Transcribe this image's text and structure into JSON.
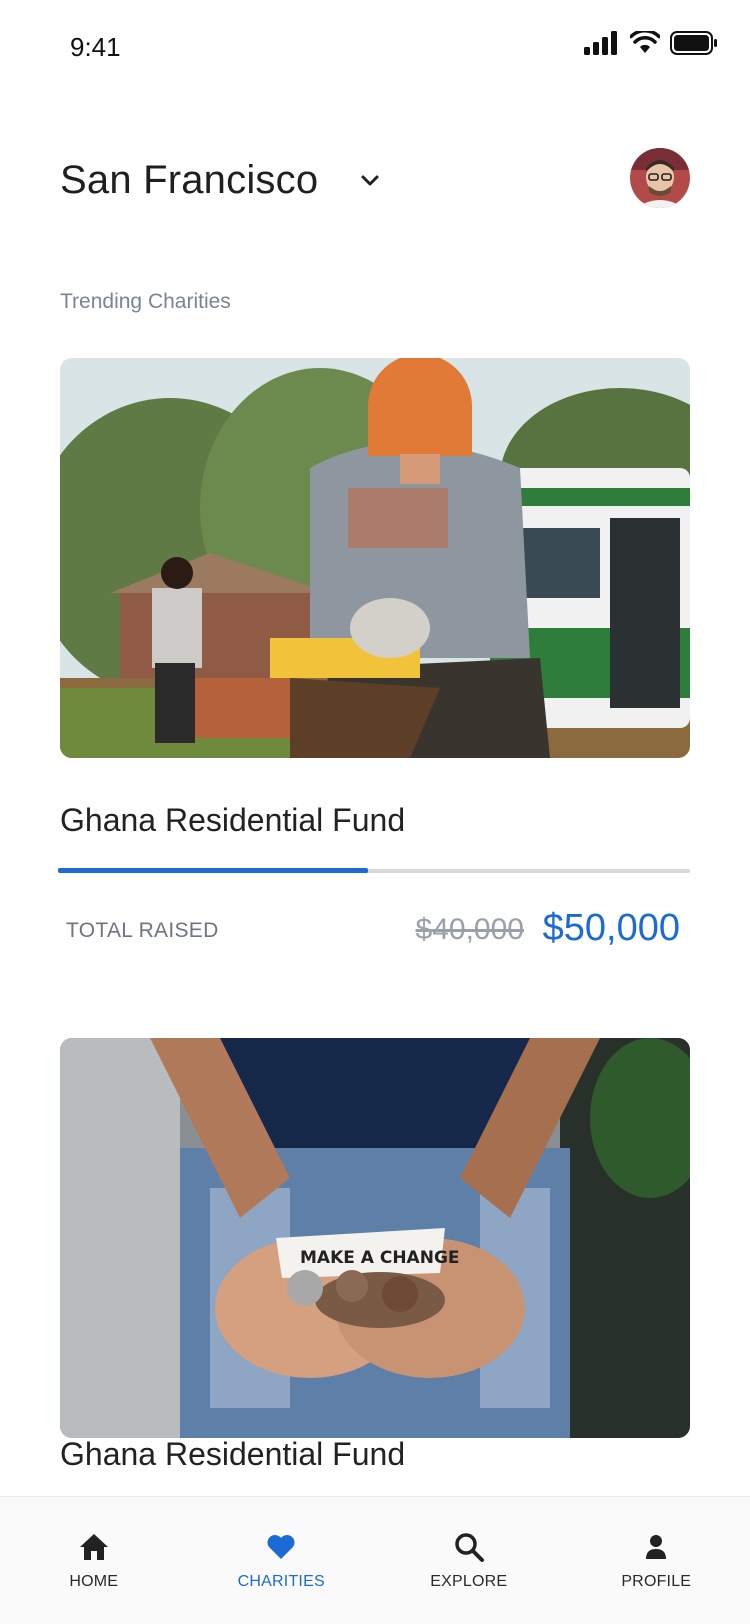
{
  "status_bar": {
    "time": "9:41"
  },
  "header": {
    "city": "San Francisco"
  },
  "section": {
    "title": "Trending Charities"
  },
  "charities": [
    {
      "title": "Ghana Residential Fund",
      "raised_label": "TOTAL RAISED",
      "old_amount": "$40,000",
      "new_amount": "$50,000",
      "progress": 0.49
    },
    {
      "title": "Ghana Residential Fund"
    }
  ],
  "tabs": [
    {
      "label": "HOME",
      "icon": "home-icon"
    },
    {
      "label": "CHARITIES",
      "icon": "heart-icon",
      "active": true
    },
    {
      "label": "EXPLORE",
      "icon": "search-icon"
    },
    {
      "label": "PROFILE",
      "icon": "person-icon"
    }
  ],
  "colors": {
    "accent": "#1b6ad6",
    "muted": "#7a8497"
  }
}
